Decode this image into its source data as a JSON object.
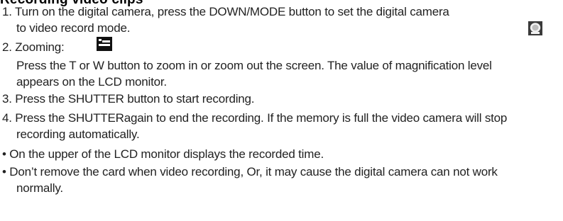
{
  "heading_partial": "Recording video clips",
  "lines": [
    "1. Turn on the digital camera, press the DOWN/MODE button to set the digital camera",
    "to video record mode.",
    "2. Zooming:",
    "Press the T or W button to zoom in or zoom out the screen. The value of magnification level",
    "appears on the LCD monitor.",
    "3. Press the SHUTTER button to start recording.",
    "4. Press the SHUTTERagain to end the recording. If the memory is full the video camera will stop",
    "recording automatically.",
    "• On the upper of the LCD monitor displays the recorded time.",
    "• Don’t remove the card when video recording, Or, it may cause the digital camera can not work",
    "normally."
  ],
  "icons": {
    "mode_icon": "camera-mode-icon",
    "video_icon": "video-mode-icon"
  }
}
